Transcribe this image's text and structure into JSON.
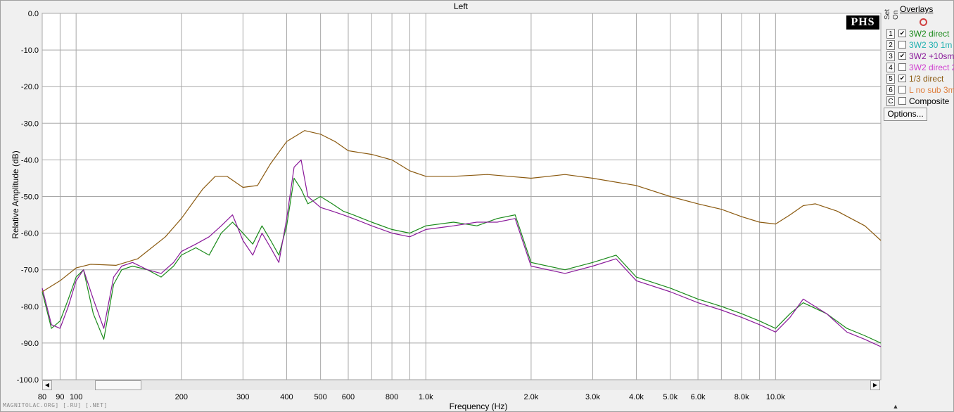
{
  "window": {
    "title": "Left"
  },
  "watermark": "MAGNITOLAC.ORG] [.RU] [.NET]",
  "logo_text": "PHS",
  "overlays": {
    "title": "Overlays",
    "header_set": "Set",
    "header_on": "On",
    "items": [
      {
        "num": "1",
        "label": "3W2 direct",
        "checked": true,
        "color": "#1a8a1a"
      },
      {
        "num": "2",
        "label": "3W2 30 1m",
        "checked": false,
        "color": "#20b0b0"
      },
      {
        "num": "3",
        "label": "3W2 +10sm",
        "checked": true,
        "color": "#8a1a9a"
      },
      {
        "num": "4",
        "label": "3W2 direct 2",
        "checked": false,
        "color": "#d040d0"
      },
      {
        "num": "5",
        "label": "1/3 direct",
        "checked": true,
        "color": "#8b5a10"
      },
      {
        "num": "6",
        "label": "L no sub 3m",
        "checked": false,
        "color": "#e08040"
      },
      {
        "num": "C",
        "label": "Composite",
        "checked": false,
        "color": "#000000"
      }
    ],
    "options_label": "Options..."
  },
  "chart_data": {
    "type": "line",
    "title": "Left",
    "xlabel": "Frequency (Hz)",
    "ylabel": "Relative Amplitude (dB)",
    "x_scale": "log",
    "xlim": [
      80,
      20000
    ],
    "ylim": [
      -100,
      0
    ],
    "x_ticks": [
      {
        "v": 80,
        "label": "80"
      },
      {
        "v": 90,
        "label": "90"
      },
      {
        "v": 100,
        "label": "100"
      },
      {
        "v": 200,
        "label": "200"
      },
      {
        "v": 300,
        "label": "300"
      },
      {
        "v": 400,
        "label": "400"
      },
      {
        "v": 500,
        "label": "500"
      },
      {
        "v": 600,
        "label": "600"
      },
      {
        "v": 800,
        "label": "800"
      },
      {
        "v": 1000,
        "label": "1.0k"
      },
      {
        "v": 2000,
        "label": "2.0k"
      },
      {
        "v": 3000,
        "label": "3.0k"
      },
      {
        "v": 4000,
        "label": "4.0k"
      },
      {
        "v": 5000,
        "label": "5.0k"
      },
      {
        "v": 6000,
        "label": "6.0k"
      },
      {
        "v": 8000,
        "label": "8.0k"
      },
      {
        "v": 10000,
        "label": "10.0k"
      }
    ],
    "x_gridlines": [
      80,
      90,
      100,
      200,
      300,
      400,
      500,
      600,
      700,
      800,
      900,
      1000,
      2000,
      3000,
      4000,
      5000,
      6000,
      7000,
      8000,
      9000,
      10000,
      20000
    ],
    "y_ticks": [
      {
        "v": 0,
        "label": "0.0"
      },
      {
        "v": -10,
        "label": "-10.0"
      },
      {
        "v": -20,
        "label": "-20.0"
      },
      {
        "v": -30,
        "label": "-30.0"
      },
      {
        "v": -40,
        "label": "-40.0"
      },
      {
        "v": -50,
        "label": "-50.0"
      },
      {
        "v": -60,
        "label": "-60.0"
      },
      {
        "v": -70,
        "label": "-70.0"
      },
      {
        "v": -80,
        "label": "-80.0"
      },
      {
        "v": -90,
        "label": "-90.0"
      },
      {
        "v": -100,
        "label": "-100.0"
      }
    ],
    "grid": true,
    "series": [
      {
        "name": "3W2 direct",
        "color": "#1a8a1a",
        "x": [
          80,
          85,
          90,
          95,
          100,
          105,
          112,
          120,
          128,
          135,
          145,
          160,
          175,
          190,
          200,
          220,
          240,
          260,
          280,
          300,
          320,
          340,
          360,
          380,
          400,
          420,
          440,
          460,
          500,
          540,
          580,
          620,
          700,
          800,
          900,
          1000,
          1200,
          1400,
          1600,
          1800,
          2000,
          2500,
          3000,
          3500,
          4000,
          5000,
          6000,
          7000,
          8000,
          9000,
          10000,
          11000,
          12000,
          14000,
          16000,
          18000,
          20000
        ],
        "y": [
          -76,
          -86,
          -84,
          -78,
          -72,
          -70,
          -82,
          -89,
          -74,
          -70,
          -69,
          -70,
          -72,
          -69,
          -66,
          -64,
          -66,
          -60,
          -57,
          -60,
          -63,
          -58,
          -62,
          -66,
          -58,
          -45,
          -48,
          -52,
          -50,
          -52,
          -54,
          -55,
          -57,
          -59,
          -60,
          -58,
          -57,
          -58,
          -56,
          -55,
          -68,
          -70,
          -68,
          -66,
          -72,
          -75,
          -78,
          -80,
          -82,
          -84,
          -86,
          -82,
          -79,
          -82,
          -86,
          -88,
          -90
        ]
      },
      {
        "name": "3W2 +10sm",
        "color": "#8a1a9a",
        "x": [
          80,
          85,
          90,
          95,
          100,
          105,
          112,
          120,
          128,
          135,
          145,
          160,
          175,
          190,
          200,
          220,
          240,
          260,
          280,
          300,
          320,
          340,
          360,
          380,
          400,
          420,
          440,
          460,
          500,
          540,
          580,
          620,
          700,
          800,
          900,
          1000,
          1200,
          1400,
          1600,
          1800,
          2000,
          2500,
          3000,
          3500,
          4000,
          5000,
          6000,
          7000,
          8000,
          9000,
          10000,
          11000,
          12000,
          14000,
          16000,
          18000,
          20000
        ],
        "y": [
          -75,
          -85,
          -86,
          -80,
          -73,
          -70,
          -78,
          -86,
          -72,
          -69,
          -68,
          -70,
          -71,
          -68,
          -65,
          -63,
          -61,
          -58,
          -55,
          -62,
          -66,
          -60,
          -64,
          -68,
          -56,
          -42,
          -40,
          -50,
          -53,
          -54,
          -55,
          -56,
          -58,
          -60,
          -61,
          -59,
          -58,
          -57,
          -57,
          -56,
          -69,
          -71,
          -69,
          -67,
          -73,
          -76,
          -79,
          -81,
          -83,
          -85,
          -87,
          -83,
          -78,
          -82,
          -87,
          -89,
          -91
        ]
      },
      {
        "name": "1/3 direct",
        "color": "#8b5a10",
        "x": [
          80,
          90,
          100,
          110,
          130,
          150,
          180,
          200,
          230,
          250,
          270,
          300,
          330,
          360,
          400,
          450,
          500,
          550,
          600,
          700,
          800,
          900,
          1000,
          1200,
          1500,
          2000,
          2500,
          3000,
          4000,
          5000,
          6000,
          7000,
          8000,
          9000,
          10000,
          11000,
          12000,
          13000,
          15000,
          18000,
          20000
        ],
        "y": [
          -76,
          -73,
          -69.5,
          -68.5,
          -68.8,
          -67,
          -61,
          -56,
          -48,
          -44.5,
          -44.5,
          -47.5,
          -47,
          -41,
          -35,
          -32,
          -33,
          -35,
          -37.5,
          -38.5,
          -40,
          -43,
          -44.5,
          -44.5,
          -44,
          -45,
          -44,
          -45,
          -47,
          -50,
          -52,
          -53.5,
          -55.5,
          -57,
          -57.5,
          -55,
          -52.5,
          -52,
          -54,
          -58,
          -62
        ]
      }
    ]
  }
}
